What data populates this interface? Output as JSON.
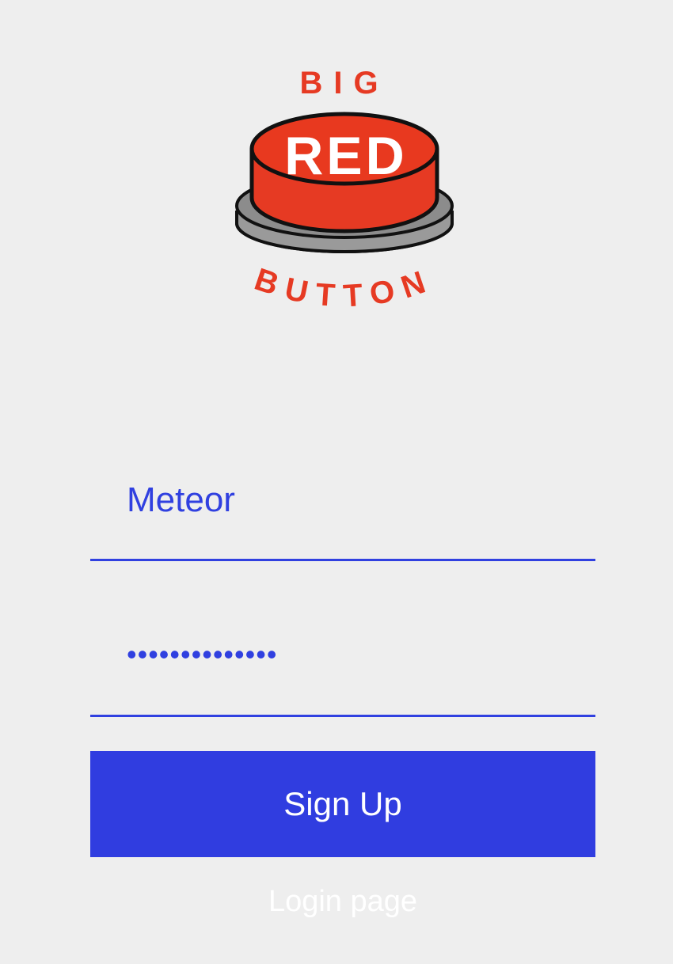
{
  "logo": {
    "text_top": "BIG",
    "text_middle": "RED",
    "text_bottom": "BUTTON",
    "colors": {
      "red": "#e63a23",
      "gray": "#9a9a9a",
      "outline": "#111111"
    }
  },
  "form": {
    "username_value": "Meteor",
    "password_value": "••••••••••••••",
    "signup_label": "Sign Up",
    "login_link_label": "Login page"
  },
  "theme": {
    "accent": "#303de0",
    "background": "#eeeeee"
  }
}
